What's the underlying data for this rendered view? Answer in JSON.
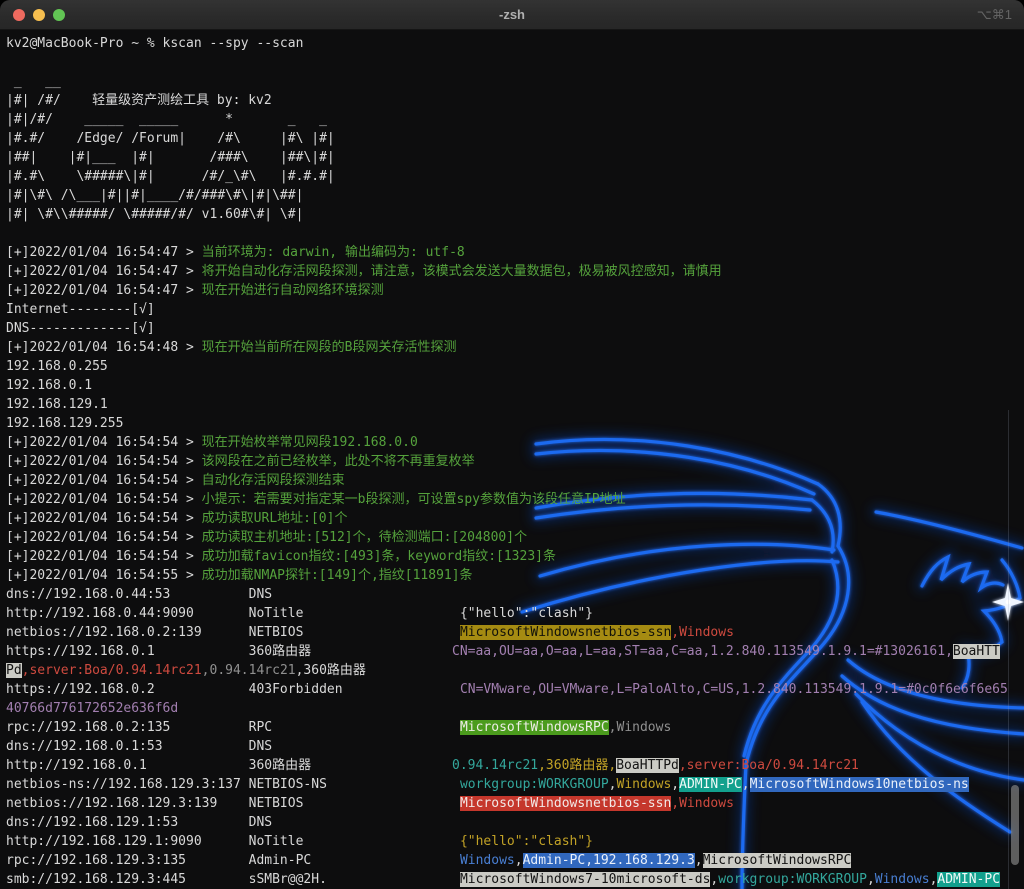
{
  "window": {
    "title": "-zsh",
    "shortcut": "⌥⌘1",
    "traffic_lights": [
      "close",
      "minimize",
      "zoom"
    ]
  },
  "palette": {
    "bg": "#0d0d0e",
    "tl-red": "#ee6a5f",
    "tl-yellow": "#f6be4f",
    "tl-green": "#62c554",
    "title-text": "#b0b0b0",
    "shortcut-text": "#646464",
    "white": "#d9d9d9",
    "green": "#55a23c",
    "red": "#ce4a3f",
    "yellow": "#c2a226",
    "purple": "#a27fb0",
    "cyan": "#33a79c",
    "blue": "#497fd3",
    "gray": "#909090",
    "hl-olive": "#a58b12",
    "hl-green": "#4b9b1d",
    "hl-red": "#c5372c",
    "hl-teal": "#12a08d",
    "hl-blue": "#3168be",
    "hl-gray": "#cbcbc5",
    "dragon-stroke": "#1c6bf0",
    "dragon-glow": "#0a3fb0",
    "sparkle": "#f0f6ff",
    "scrollbar": "#8a8a8a"
  },
  "terminal": {
    "prompt": "kv2@MacBook-Pro ~ %",
    "command": "kscan --spy --scan",
    "lines": [
      [
        [
          "kv2@MacBook-Pro ~ % kscan --spy --scan",
          "w"
        ]
      ],
      [],
      [
        [
          " _   __",
          "w"
        ]
      ],
      [
        [
          "|#| /#/    轻量级资产测绘工具 by: kv2",
          "w"
        ]
      ],
      [
        [
          "|#|/#/    _____  _____      *       _   _",
          "w"
        ]
      ],
      [
        [
          "|#.#/    /Edge/ /Forum|    /#\\     |#\\ |#|",
          "w"
        ]
      ],
      [
        [
          "|##|    |#|___  |#|       /###\\    |##\\|#|",
          "w"
        ]
      ],
      [
        [
          "|#.#\\    \\#####\\|#|      /#/_\\#\\   |#.#.#|",
          "w"
        ]
      ],
      [
        [
          "|#|\\#\\ /\\___|#||#|____/#/###\\#\\|#|\\##|",
          "w"
        ]
      ],
      [
        [
          "|#| \\#\\\\#####/ \\#####/#/ v1.60#\\#| \\#|",
          "w"
        ]
      ],
      [],
      [
        [
          "[+]2022/01/04 16:54:47 > ",
          "w"
        ],
        [
          "当前环境为: darwin, 输出编码为: utf-8",
          "g"
        ]
      ],
      [
        [
          "[+]2022/01/04 16:54:47 > ",
          "w"
        ],
        [
          "将开始自动化存活网段探测，请注意，该模式会发送大量数据包，极易被风控感知，请慎用",
          "g"
        ]
      ],
      [
        [
          "[+]2022/01/04 16:54:47 > ",
          "w"
        ],
        [
          "现在开始进行自动网络环境探测",
          "g"
        ]
      ],
      [
        [
          "Internet--------[√]",
          "w"
        ]
      ],
      [
        [
          "DNS-------------[√]",
          "w"
        ]
      ],
      [
        [
          "[+]2022/01/04 16:54:48 > ",
          "w"
        ],
        [
          "现在开始当前所在网段的B段网关存活性探测",
          "g"
        ]
      ],
      [
        [
          "192.168.0.255",
          "w"
        ]
      ],
      [
        [
          "192.168.0.1",
          "w"
        ]
      ],
      [
        [
          "192.168.129.1",
          "w"
        ]
      ],
      [
        [
          "192.168.129.255",
          "w"
        ]
      ],
      [
        [
          "[+]2022/01/04 16:54:54 > ",
          "w"
        ],
        [
          "现在开始枚举常见网段192.168.0.0",
          "g"
        ]
      ],
      [
        [
          "[+]2022/01/04 16:54:54 > ",
          "w"
        ],
        [
          "该网段在之前已经枚举，此处不将不再重复枚举",
          "g"
        ]
      ],
      [
        [
          "[+]2022/01/04 16:54:54 > ",
          "w"
        ],
        [
          "自动化存活网段探测结束",
          "g"
        ]
      ],
      [
        [
          "[+]2022/01/04 16:54:54 > ",
          "w"
        ],
        [
          "小提示：若需要对指定某一b段探测，可设置spy参数值为该段任意IP地址",
          "g"
        ]
      ],
      [
        [
          "[+]2022/01/04 16:54:54 > ",
          "w"
        ],
        [
          "成功读取URL地址:[0]个",
          "g"
        ]
      ],
      [
        [
          "[+]2022/01/04 16:54:54 > ",
          "w"
        ],
        [
          "成功读取主机地址:[512]个，待检测端口:[204800]个",
          "g"
        ]
      ],
      [
        [
          "[+]2022/01/04 16:54:54 > ",
          "w"
        ],
        [
          "成功加载favicon指纹:[493]条，keyword指纹:[1323]条",
          "g"
        ]
      ],
      [
        [
          "[+]2022/01/04 16:54:55 > ",
          "w"
        ],
        [
          "成功加载NMAP探针:[149]个,指纹[11891]条",
          "g"
        ]
      ],
      [
        [
          "dns://192.168.0.44:53          DNS",
          "w"
        ]
      ],
      [
        [
          "http://192.168.0.44:9090       NoTitle                    ",
          "w"
        ],
        [
          "{\"hello\":\"clash\"}",
          "w"
        ]
      ],
      [
        [
          "netbios://192.168.0.2:139      NETBIOS                    ",
          "w"
        ],
        [
          "MicrosoftWindowsnetbios-ssn",
          "hl-olive"
        ],
        [
          ",Windows",
          "r"
        ]
      ],
      [
        [
          "https://192.168.0.1            360路由器                  ",
          "w"
        ],
        [
          "CN=aa,OU=aa,O=aa,L=aa,ST=aa,C=aa,1.2.840.113549.1.9.1=#13026161,",
          "p"
        ],
        [
          "BoaHTT",
          "hl-gray"
        ]
      ],
      [
        [
          "Pd",
          "hl-gray"
        ],
        [
          ",server:Boa/0.94.14rc21",
          "r"
        ],
        [
          ",0.94.14rc21",
          "gy"
        ],
        [
          ",360路由器",
          "w"
        ]
      ],
      [
        [
          "https://192.168.0.2            403Forbidden               ",
          "w"
        ],
        [
          "CN=VMware,OU=VMware,L=PaloAlto,C=US,1.2.840.113549.1.9.1=#0c0f6e6f6e65",
          "p"
        ]
      ],
      [
        [
          "40766d776172652e636f6d",
          "p"
        ]
      ],
      [
        [
          "rpc://192.168.0.2:135          RPC                        ",
          "w"
        ],
        [
          "MicrosoftWindowsRPC",
          "hl-green"
        ],
        [
          ",Windows",
          "gy"
        ]
      ],
      [
        [
          "dns://192.168.0.1:53           DNS",
          "w"
        ]
      ],
      [
        [
          "http://192.168.0.1             360路由器                  ",
          "w"
        ],
        [
          "0.94.14rc21",
          "c"
        ],
        [
          ",360路由器,",
          "y"
        ],
        [
          "BoaHTTPd",
          "hl-gray"
        ],
        [
          ",server:Boa/0.94.14rc21",
          "r"
        ]
      ],
      [
        [
          "netbios-ns://192.168.129.3:137 NETBIOS-NS                 ",
          "w"
        ],
        [
          "workgroup:WORKGROUP",
          "c"
        ],
        [
          ",",
          "w"
        ],
        [
          "Windows",
          "y"
        ],
        [
          ",",
          "w"
        ],
        [
          "ADMIN-PC",
          "hl-teal"
        ],
        [
          ",",
          "w"
        ],
        [
          "MicrosoftWindows10netbios-ns",
          "hl-blue"
        ]
      ],
      [
        [
          "netbios://192.168.129.3:139    NETBIOS                    ",
          "w"
        ],
        [
          "MicrosoftWindowsnetbios-ssn",
          "hl-red"
        ],
        [
          ",Windows",
          "r"
        ]
      ],
      [
        [
          "dns://192.168.129.1:53         DNS",
          "w"
        ]
      ],
      [
        [
          "http://192.168.129.1:9090      NoTitle                    ",
          "w"
        ],
        [
          "{\"hello\":\"clash\"}",
          "y"
        ]
      ],
      [
        [
          "rpc://192.168.129.3:135        Admin-PC                   ",
          "w"
        ],
        [
          "Windows",
          "b"
        ],
        [
          ",",
          "w"
        ],
        [
          "Admin-PC,192.168.129.3",
          "hl-blue"
        ],
        [
          ",",
          "w"
        ],
        [
          "MicrosoftWindowsRPC",
          "hl-gray"
        ]
      ],
      [
        [
          "smb://192.168.129.3:445        sSMBr@@2H.                 ",
          "w"
        ],
        [
          "MicrosoftWindows7-10microsoft-ds",
          "hl-gray"
        ],
        [
          ",",
          "w"
        ],
        [
          "workgroup:WORKGROUP",
          "c"
        ],
        [
          ",",
          "w"
        ],
        [
          "Windows",
          "b"
        ],
        [
          ",",
          "w"
        ],
        [
          "ADMIN-PC",
          "hl-teal"
        ]
      ]
    ]
  }
}
